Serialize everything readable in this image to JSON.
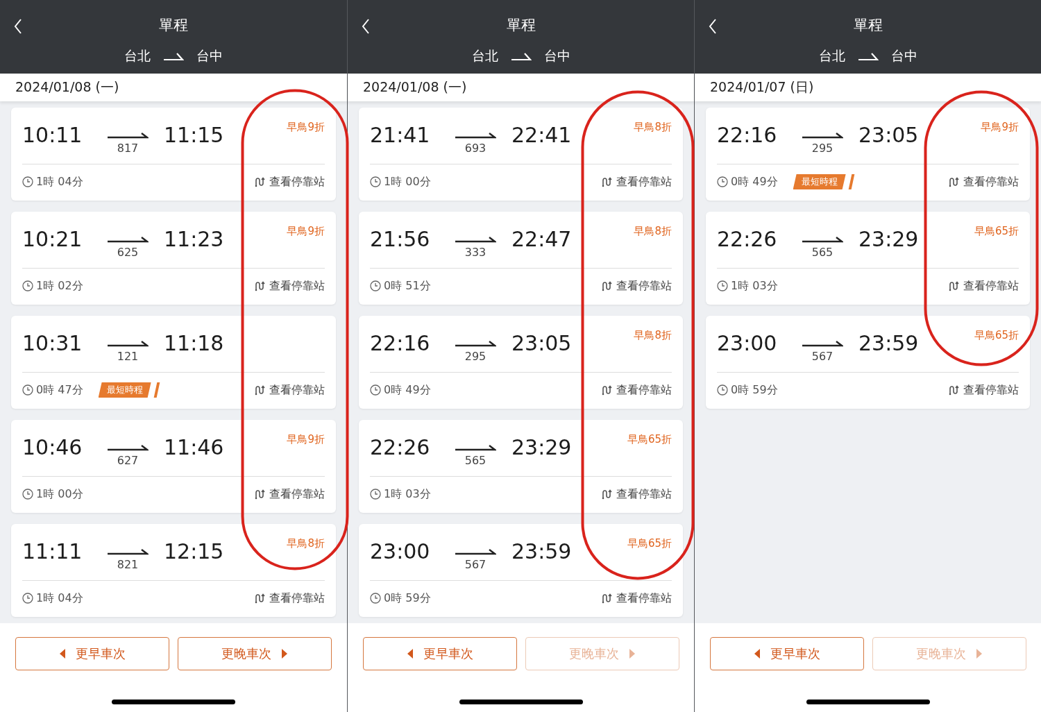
{
  "panels": [
    {
      "header": {
        "title": "單程",
        "from": "台北",
        "to": "台中"
      },
      "date": "2024/01/08 (一)",
      "trips": [
        {
          "depart": "10:11",
          "arrive": "11:15",
          "train": "817",
          "discount": "早鳥9折",
          "duration": "1時 04分",
          "shortest": false,
          "stops_link": "查看停靠站"
        },
        {
          "depart": "10:21",
          "arrive": "11:23",
          "train": "625",
          "discount": "早鳥9折",
          "duration": "1時 02分",
          "shortest": false,
          "stops_link": "查看停靠站"
        },
        {
          "depart": "10:31",
          "arrive": "11:18",
          "train": "121",
          "duration": "0時 47分",
          "shortest": true,
          "badge": "最短時程",
          "stops_link": "查看停靠站"
        },
        {
          "depart": "10:46",
          "arrive": "11:46",
          "train": "627",
          "discount": "早鳥9折",
          "duration": "1時 00分",
          "shortest": false,
          "stops_link": "查看停靠站"
        },
        {
          "depart": "11:11",
          "arrive": "12:15",
          "train": "821",
          "discount": "早鳥8折",
          "duration": "1時 04分",
          "shortest": false,
          "stops_link": "查看停靠站"
        }
      ],
      "buttons": {
        "earlier": {
          "label": "更早車次",
          "disabled": false
        },
        "later": {
          "label": "更晚車次",
          "disabled": false
        }
      }
    },
    {
      "header": {
        "title": "單程",
        "from": "台北",
        "to": "台中"
      },
      "date": "2024/01/08 (一)",
      "trips": [
        {
          "depart": "21:41",
          "arrive": "22:41",
          "train": "693",
          "discount": "早鳥8折",
          "duration": "1時 00分",
          "shortest": false,
          "stops_link": "查看停靠站"
        },
        {
          "depart": "21:56",
          "arrive": "22:47",
          "train": "333",
          "discount": "早鳥8折",
          "duration": "0時 51分",
          "shortest": false,
          "stops_link": "查看停靠站"
        },
        {
          "depart": "22:16",
          "arrive": "23:05",
          "train": "295",
          "discount": "早鳥8折",
          "duration": "0時 49分",
          "shortest": false,
          "stops_link": "查看停靠站"
        },
        {
          "depart": "22:26",
          "arrive": "23:29",
          "train": "565",
          "discount": "早鳥65折",
          "duration": "1時 03分",
          "shortest": false,
          "stops_link": "查看停靠站"
        },
        {
          "depart": "23:00",
          "arrive": "23:59",
          "train": "567",
          "discount": "早鳥65折",
          "duration": "0時 59分",
          "shortest": false,
          "stops_link": "查看停靠站"
        }
      ],
      "buttons": {
        "earlier": {
          "label": "更早車次",
          "disabled": false
        },
        "later": {
          "label": "更晚車次",
          "disabled": true
        }
      }
    },
    {
      "header": {
        "title": "單程",
        "from": "台北",
        "to": "台中"
      },
      "date": "2024/01/07 (日)",
      "trips": [
        {
          "depart": "22:16",
          "arrive": "23:05",
          "train": "295",
          "discount": "早鳥9折",
          "duration": "0時 49分",
          "shortest": true,
          "badge": "最短時程",
          "stops_link": "查看停靠站"
        },
        {
          "depart": "22:26",
          "arrive": "23:29",
          "train": "565",
          "discount": "早鳥65折",
          "duration": "1時 03分",
          "shortest": false,
          "stops_link": "查看停靠站"
        },
        {
          "depart": "23:00",
          "arrive": "23:59",
          "train": "567",
          "discount": "早鳥65折",
          "duration": "0時 59分",
          "shortest": false,
          "stops_link": "查看停靠站"
        }
      ],
      "buttons": {
        "earlier": {
          "label": "更早車次",
          "disabled": false
        },
        "later": {
          "label": "更晚車次",
          "disabled": true
        }
      }
    }
  ]
}
